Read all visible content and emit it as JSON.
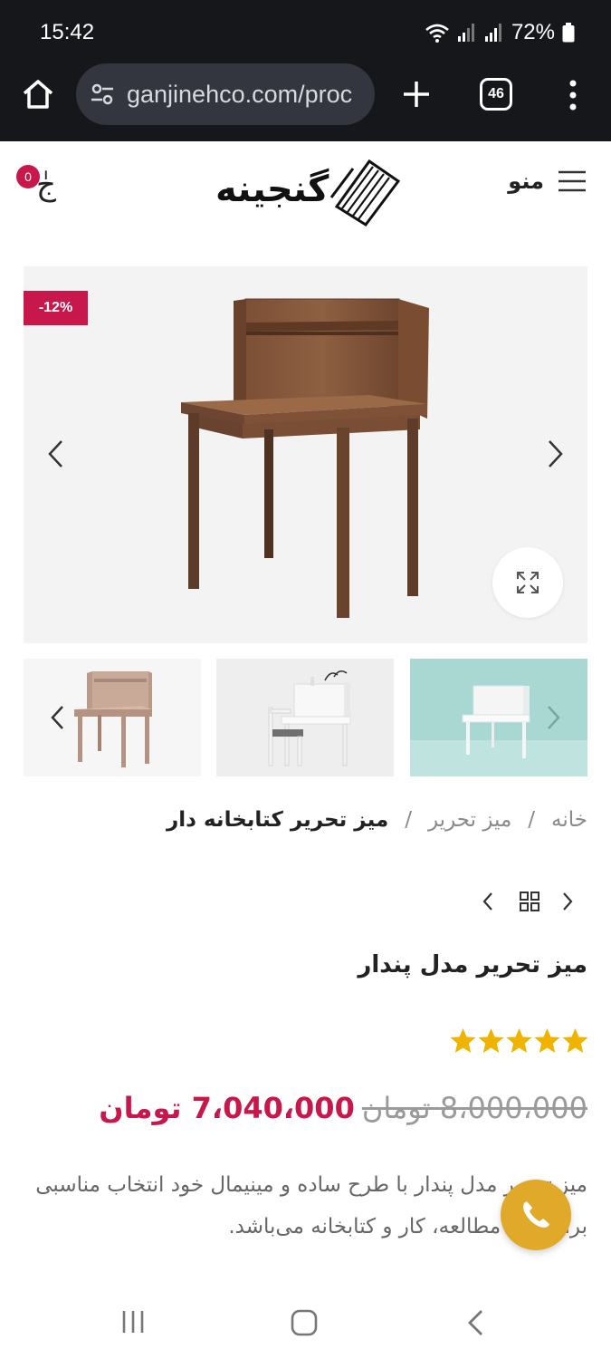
{
  "status_bar": {
    "time": "15:42",
    "battery": "72%"
  },
  "browser": {
    "url": "ganjinehco.com/proc",
    "tab_count": "46"
  },
  "header": {
    "menu_label": "منو",
    "logo_text": "گنجینه",
    "cart_count": "0",
    "cart_glyph": "جٰ"
  },
  "gallery": {
    "discount": "-12%"
  },
  "breadcrumb": {
    "items": [
      "خانه",
      "میز تحریر",
      "میز تحریر کتابخانه دار"
    ],
    "separator": "/"
  },
  "product": {
    "title": "میز تحریر مدل پندار",
    "rating": 5,
    "old_price": "8،000،000 تومان",
    "new_price": "7،040،000 تومان",
    "description": "میز تحریر مدل پندار با طرح ساده و مینیمال خود انتخاب مناسبی برای اتاق مطالعه، کار و کتابخانه می‌باشد."
  },
  "colors": {
    "accent": "#c8174a",
    "call": "#e0a92a",
    "chrome": "#16171b",
    "star": "#f0b400"
  }
}
